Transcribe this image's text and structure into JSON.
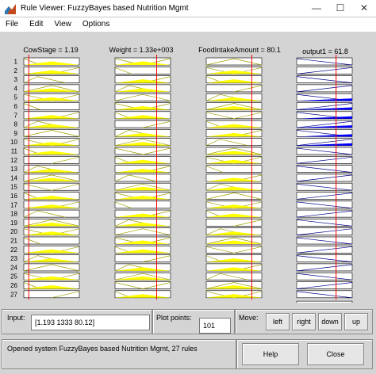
{
  "window": {
    "title": "Rule Viewer: FuzzyBayes based Nutrition Mgmt",
    "controls": [
      "—",
      "☐",
      "✕"
    ]
  },
  "menu": [
    "File",
    "Edit",
    "View",
    "Options"
  ],
  "variables": [
    {
      "label": "CowStage = 1.19",
      "marker": 0.09
    },
    {
      "label": "Weight = 1.33e+003",
      "marker": 0.75
    },
    {
      "label": "FoodIntakeAmount = 80.1",
      "marker": 0.82
    },
    {
      "label": "output1 = 61.8",
      "marker": 0.71
    }
  ],
  "rules": [
    "1",
    "2",
    "3",
    "4",
    "5",
    "6",
    "7",
    "8",
    "9",
    "10",
    "11",
    "12",
    "13",
    "14",
    "15",
    "16",
    "17",
    "18",
    "19",
    "20",
    "21",
    "22",
    "23",
    "24",
    "25",
    "26",
    "27"
  ],
  "colors": {
    "input_fill": "#ffff00",
    "output_fill": "#0000ff",
    "marker": "#ff0000",
    "curve": "#a0a000",
    "out_curve": "#00008b"
  },
  "input_panel": {
    "label": "Input:",
    "value": "[1.193 1333 80.12]"
  },
  "plot_panel": {
    "label": "Plot points:",
    "value": "101"
  },
  "move_panel": {
    "label": "Move:",
    "buttons": [
      "left",
      "right",
      "down",
      "up"
    ]
  },
  "status": "Opened system FuzzyBayes based Nutrition Mgmt, 27 rules",
  "help_label": "Help",
  "close_label": "Close"
}
